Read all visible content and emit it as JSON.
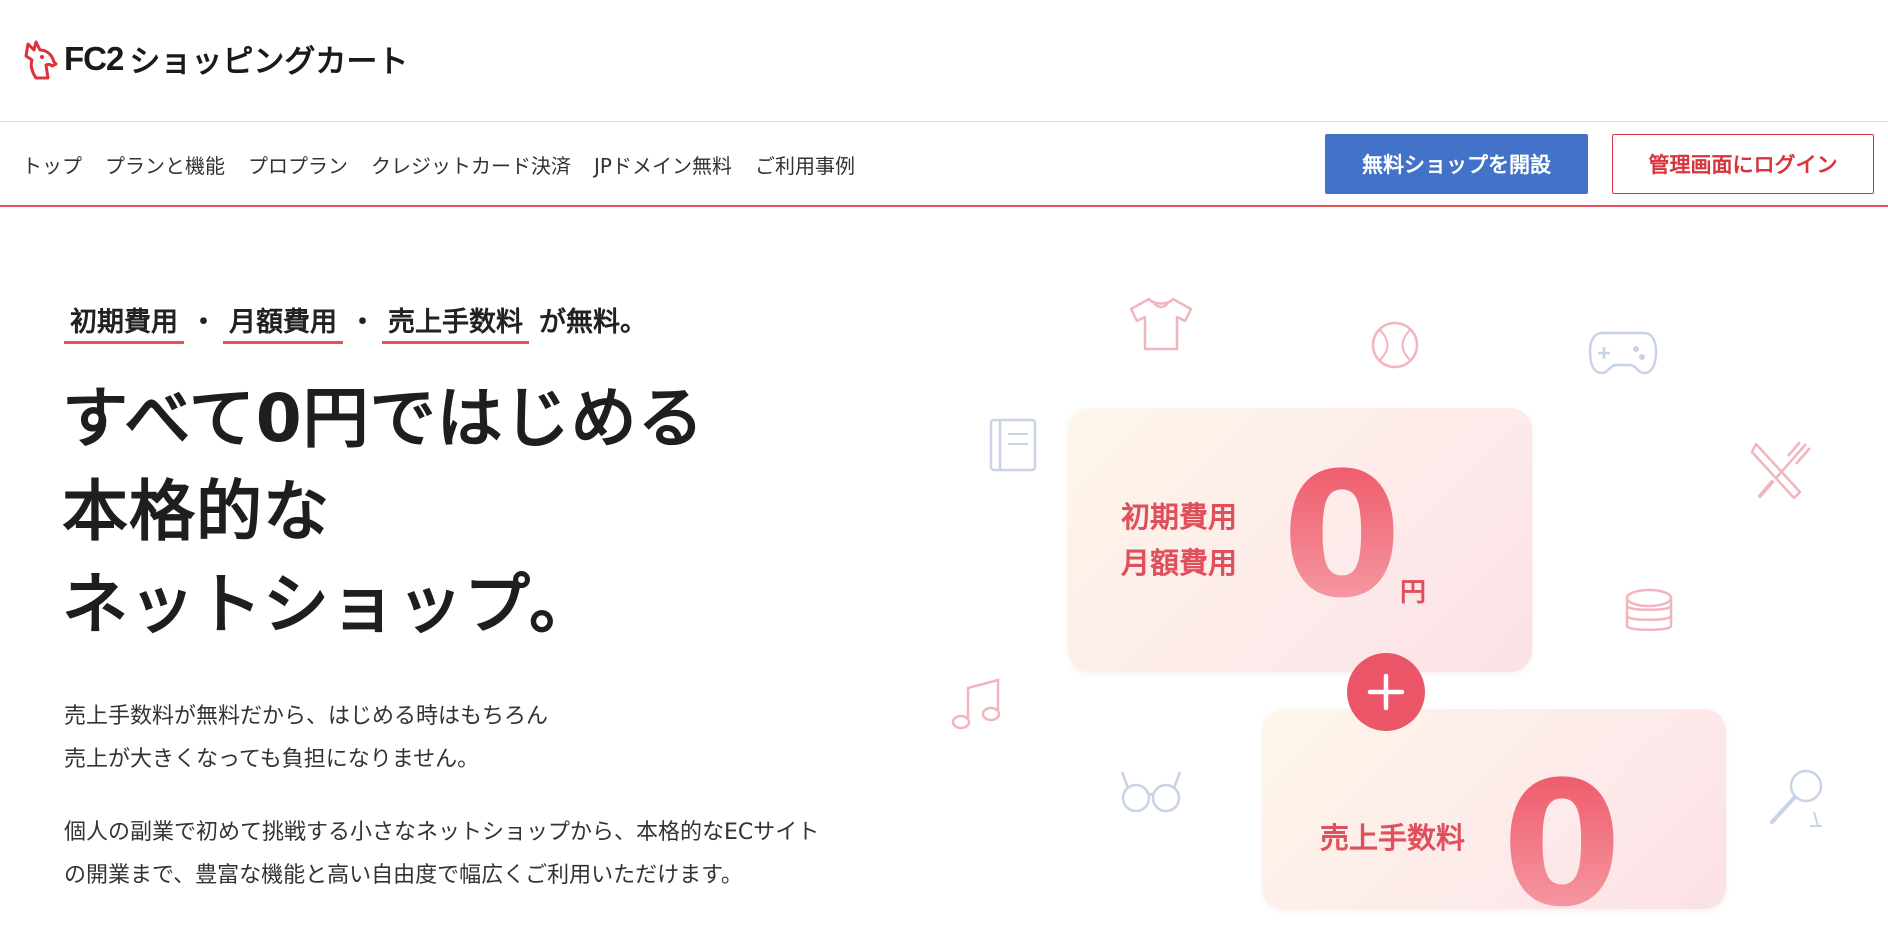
{
  "header": {
    "logo_fc2": "FC2",
    "logo_text": "ショッピングカート"
  },
  "nav": {
    "items": [
      {
        "label": "トップ"
      },
      {
        "label": "プランと機能"
      },
      {
        "label": "プロプラン"
      },
      {
        "label": "クレジットカード決済"
      },
      {
        "label": "JPドメイン無料"
      },
      {
        "label": "ご利用事例"
      }
    ],
    "open_shop_button": "無料ショップを開設",
    "login_button": "管理画面にログイン"
  },
  "hero": {
    "tagline": {
      "item1": "初期費用",
      "dot1": "・",
      "item2": "月額費用",
      "dot2": "・",
      "item3": "売上手数料",
      "tail": "が無料。"
    },
    "headline": {
      "line1": "すべて0円ではじめる",
      "line2": "本格的な",
      "line3": "ネットショップ。"
    },
    "description": {
      "line1": "売上手数料が無料だから、はじめる時はもちろん",
      "line2": "売上が大きくなっても負担になりません。",
      "line3": "個人の副業で初めて挑戦する小さなネットショップから、本格的なECサイト",
      "line4": "の開業まで、豊富な機能と高い自由度で幅広くご利用いただけます。"
    }
  },
  "cards": {
    "card1": {
      "label_line1": "初期費用",
      "label_line2": "月額費用",
      "value": "0",
      "unit": "円"
    },
    "card2": {
      "label_line1": "売上手数料",
      "value": "0"
    }
  },
  "colors": {
    "accent_red": "#e8515a",
    "button_blue": "#4273c8",
    "login_red": "#d9333c"
  },
  "icons": [
    "unicorn-logo-icon",
    "tshirt-icon",
    "baseball-icon",
    "gamepad-icon",
    "book-icon",
    "fork-knife-icon",
    "pancake-icon",
    "music-note-icon",
    "glasses-icon",
    "magnifier-icon",
    "plus-icon"
  ]
}
